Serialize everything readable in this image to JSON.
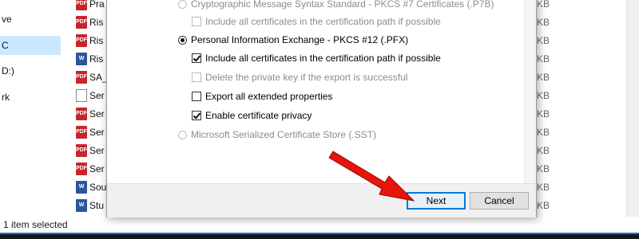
{
  "explorer": {
    "nav_items": [
      "ve",
      "C",
      "D:)",
      "rk"
    ],
    "files": [
      {
        "icon": "pdf",
        "name": "Pra"
      },
      {
        "icon": "pdf",
        "name": "Ris"
      },
      {
        "icon": "pdf",
        "name": "Ris"
      },
      {
        "icon": "word",
        "name": "Ris"
      },
      {
        "icon": "pdf",
        "name": "SA_"
      },
      {
        "icon": "txt",
        "name": "Ser"
      },
      {
        "icon": "pdf",
        "name": "Ser"
      },
      {
        "icon": "pdf",
        "name": "Ser"
      },
      {
        "icon": "pdf",
        "name": "Ser"
      },
      {
        "icon": "pdf",
        "name": "Ser"
      },
      {
        "icon": "word",
        "name": "Sou"
      },
      {
        "icon": "word",
        "name": "Stu"
      },
      {
        "icon": "word",
        "name": "Stu"
      }
    ],
    "size_unit": "KB",
    "status": "1 item selected"
  },
  "dialog": {
    "options": {
      "pkcs7": "Cryptographic Message Syntax Standard - PKCS #7 Certificates (.P7B)",
      "pkcs7_include": "Include all certificates in the certification path if possible",
      "pfx": "Personal Information Exchange - PKCS #12 (.PFX)",
      "pfx_include": "Include all certificates in the certification path if possible",
      "delete_key": "Delete the private key if the export is successful",
      "export_props": "Export all extended properties",
      "privacy": "Enable certificate privacy",
      "sst": "Microsoft Serialized Certificate Store (.SST)"
    },
    "buttons": {
      "next": "Next",
      "cancel": "Cancel"
    }
  },
  "annotation": {
    "arrow_color": "#e8150d",
    "icon": "red-arrow-icon"
  }
}
